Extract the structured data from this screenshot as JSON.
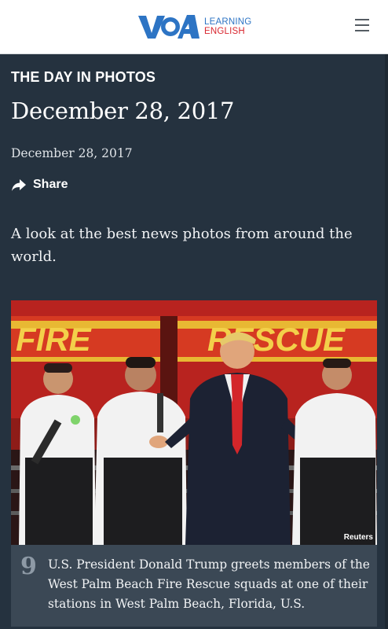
{
  "header": {
    "brand_mark": "VOA",
    "brand_line1": "LEARNING",
    "brand_line2": "ENGLISH",
    "menu_icon": "hamburger-menu-icon"
  },
  "article": {
    "section": "THE DAY IN PHOTOS",
    "title": "December 28, 2017",
    "date": "December 28, 2017",
    "share_label": "Share",
    "share_icon": "share-arrow-icon",
    "intro": "A look at the best news photos from around the world."
  },
  "photo": {
    "sign_left": "FIRE",
    "sign_right": "RESCUE",
    "credit": "Reuters",
    "number": "9",
    "caption": "U.S. President Donald Trump greets members of the West Palm Beach Fire Rescue squads at one of their stations in West Palm Beach, Florida, U.S."
  },
  "colors": {
    "background": "#25323f",
    "caption_background": "#3b4855",
    "brand_blue": "#2d74c4",
    "brand_red": "#d8262f"
  }
}
